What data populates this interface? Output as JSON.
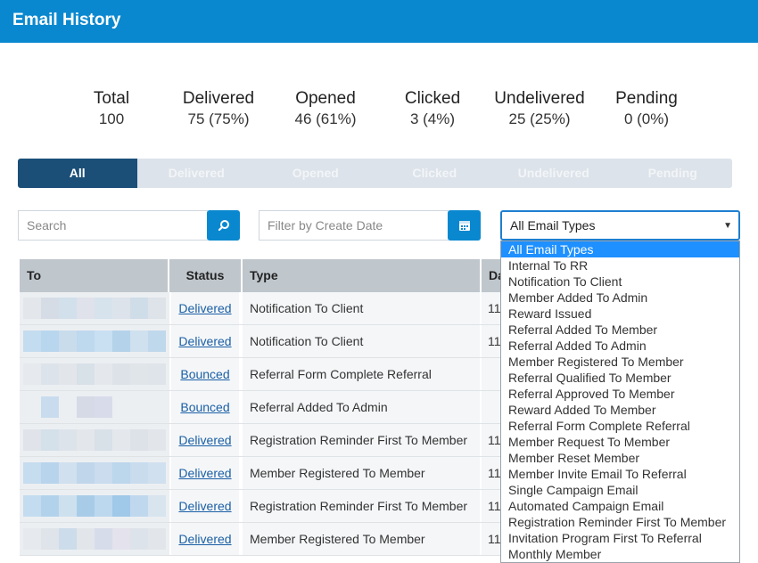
{
  "header": {
    "title": "Email History"
  },
  "stats": [
    {
      "label": "Total",
      "value": "100"
    },
    {
      "label": "Delivered",
      "value": "75 (75%)"
    },
    {
      "label": "Opened",
      "value": "46 (61%)"
    },
    {
      "label": "Clicked",
      "value": "3 (4%)"
    },
    {
      "label": "Undelivered",
      "value": "25 (25%)"
    },
    {
      "label": "Pending",
      "value": "0 (0%)"
    }
  ],
  "tabs": [
    "All",
    "Delivered",
    "Opened",
    "Clicked",
    "Undelivered",
    "Pending"
  ],
  "filters": {
    "search_placeholder": "Search",
    "date_placeholder": "Filter by Create Date",
    "type_selected": "All Email Types",
    "search_icon": "search-icon",
    "calendar_icon": "calendar-icon",
    "accent_color": "#0a88cf"
  },
  "table": {
    "headers": [
      "To",
      "Status",
      "Type",
      "Da"
    ],
    "rows": [
      {
        "status": "Delivered",
        "type": "Notification To Client",
        "date": "11"
      },
      {
        "status": "Delivered",
        "type": "Notification To Client",
        "date": "11"
      },
      {
        "status": "Bounced",
        "type": "Referral Form Complete Referral",
        "date": ""
      },
      {
        "status": "Bounced",
        "type": "Referral Added To Admin",
        "date": ""
      },
      {
        "status": "Delivered",
        "type": "Registration Reminder First To Member",
        "date": "11"
      },
      {
        "status": "Delivered",
        "type": "Member Registered To Member",
        "date": "11"
      },
      {
        "status": "Delivered",
        "type": "Registration Reminder First To Member",
        "date": "11"
      },
      {
        "status": "Delivered",
        "type": "Member Registered To Member",
        "date": "11"
      }
    ]
  },
  "email_type_options": [
    "All Email Types",
    "Internal To RR",
    "Notification To Client",
    "Member Added To Admin",
    "Reward Issued",
    "Referral Added To Member",
    "Referral Added To Admin",
    "Member Registered To Member",
    "Referral Qualified To Member",
    "Referral Approved To Member",
    "Reward Added To Member",
    "Referral Form Complete Referral",
    "Member Request To Member",
    "Member Reset Member",
    "Member Invite Email To Referral",
    "Single Campaign Email",
    "Automated Campaign Email",
    "Registration Reminder First To Member",
    "Invitation Program First To Referral",
    "Monthly Member"
  ]
}
